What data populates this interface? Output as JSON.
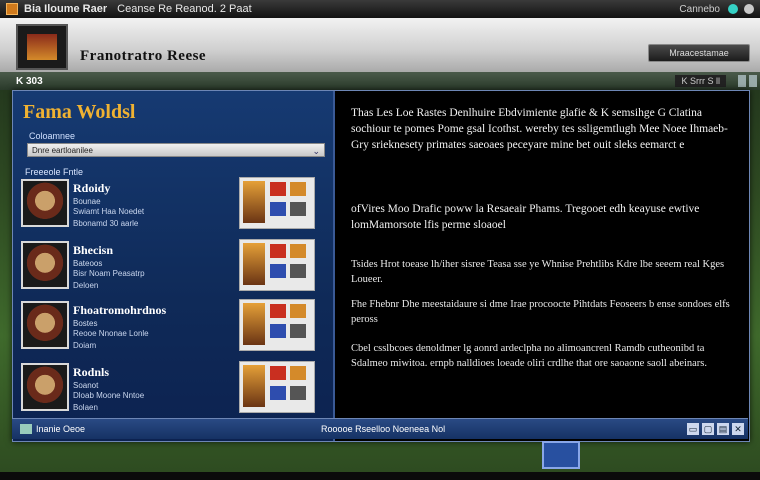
{
  "topbar": {
    "title": "Bia Iloume Raer",
    "subtitle": "Ceanse Re Reanod. 2 Paat",
    "right_label": "Cannebo"
  },
  "header": {
    "title": "Franotratro Reese",
    "button_label": "Mraacestamae"
  },
  "strip": {
    "left_label": "K 303",
    "right_label": "K Srrr S ll"
  },
  "panel": {
    "heading": "Fama Woldsl",
    "section_label": "Coloamnee",
    "select_value": "Dnre eartloanilee",
    "list_title": "Freeeole Fntle",
    "items": [
      {
        "name": "Rdoidy",
        "sub": "Bounae",
        "desc": "Swiamt Haa Noedet",
        "extra": "Bbonamd 30 aarle"
      },
      {
        "name": "Bhecisn",
        "sub": "Bateoos",
        "desc": "Bisr Noam Peasatrp",
        "extra": "Deloen"
      },
      {
        "name": "Fhoatromohrdnos",
        "sub": "Bostes",
        "desc": "Reooe Nnonae Lonle",
        "extra": "Doiam"
      },
      {
        "name": "Rodnls",
        "sub": "Soanot",
        "desc": "Dloab Moone Nntoe",
        "extra": "Bolaen"
      }
    ]
  },
  "content": {
    "p1": "Thas Les Loe Rastes Denlhuire Ebdvimiente glafie & K semsihge G Clatina sochiour te pomes Pome gsal Icothst. wereby tes ssligemtlugh Mee Noee Ihmaeb-Gry srieknesety primates saeoaes peceyare mine bet ouit sleks eemarct e",
    "p2": "ofVires Moo Drafic poww la Resaeair Phams. Tregooet edh keayuse ewtive lomMamorsote lfis perme sloaoel",
    "bullets": [
      "Tsides Hrot toease lh/iher sisree Teasa sse ye Whnise Prehtlibs Kdre lbe seeem real Kges Loueer.",
      "Fhe Fhebnr Dhe meestaidaure si dme Irae procoocte Pihtdats Feoseers b ense sondoes elfs peross",
      "Cbel csslbcoes denoldmer lg aonrd ardeclpha no alimoancrenl Ramdb cutheonibd ta Sdalmeo miwitoa. ernpb nalldioes loeade oliri crdlhe that ore saoaone saoll abeinars."
    ]
  },
  "bottombar": {
    "left_label": "Inanie Oeoe",
    "center_label": "Rooooe Rseelloo Noeneea Nol"
  }
}
